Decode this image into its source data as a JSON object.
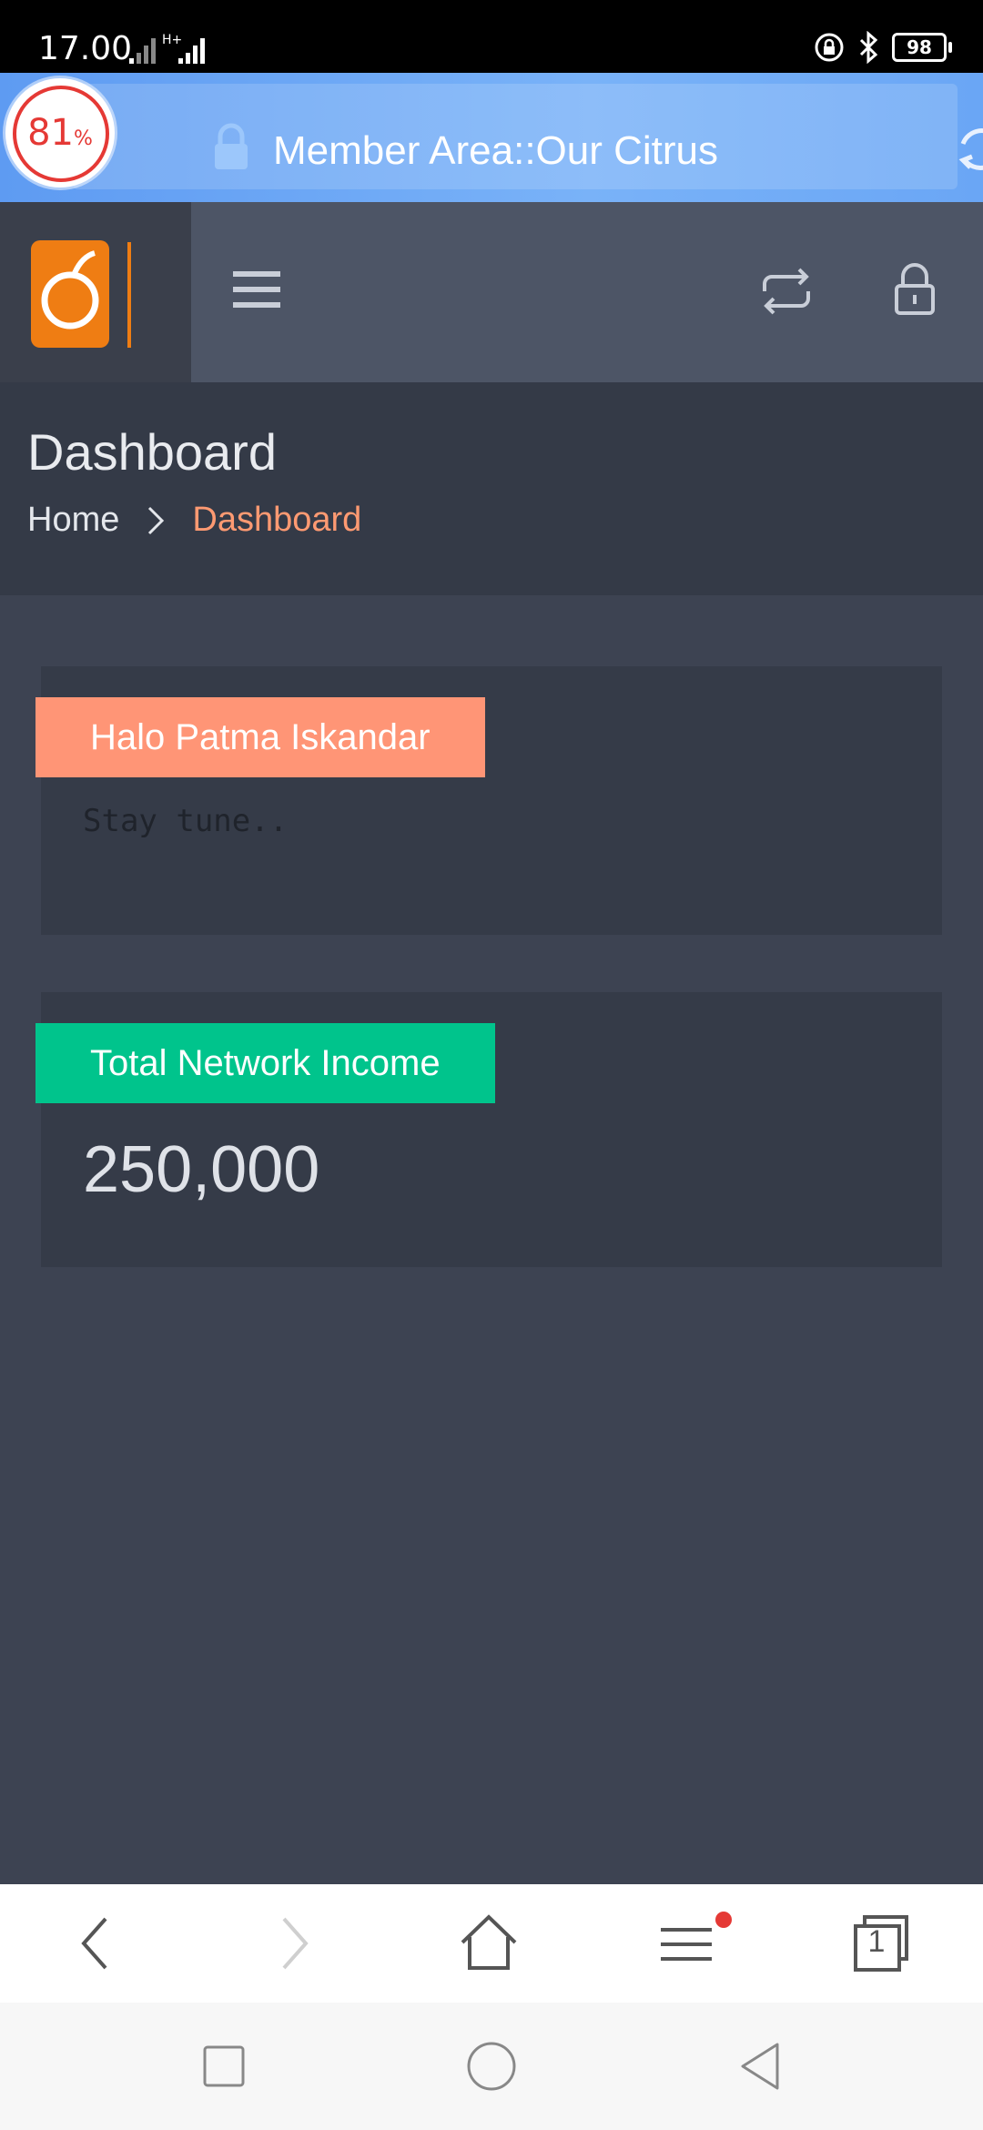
{
  "status_bar": {
    "time": "17.00",
    "network_label": "H+",
    "battery": "98"
  },
  "browser": {
    "load_progress": "81",
    "load_progress_unit": "%",
    "url_title": "Member Area::Our Citrus"
  },
  "header": {
    "logo_name": "orange-logo-icon",
    "menu_icon": "hamburger-icon",
    "switch_icon": "swap-icon",
    "lock_icon": "lock-icon"
  },
  "page": {
    "title": "Dashboard",
    "breadcrumb": {
      "home": "Home",
      "current": "Dashboard"
    }
  },
  "cards": [
    {
      "label": "Halo Patma Iskandar",
      "text": "Stay tune..",
      "color": "#ff9576"
    },
    {
      "label": "Total Network Income",
      "value": "250,000",
      "color": "#00c48c"
    }
  ],
  "toolbar": {
    "tab_count": "1"
  },
  "colors": {
    "accent": "#ff9a72",
    "header_bg": "#4d5566",
    "page_bg": "#3d4352",
    "browser_bar": "#6aa6f5"
  }
}
